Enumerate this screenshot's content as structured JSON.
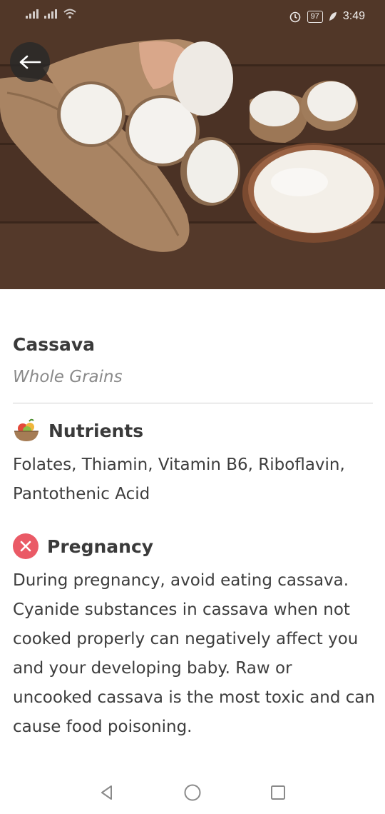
{
  "status_bar": {
    "time": "3:49",
    "battery": "97"
  },
  "food": {
    "name": "Cassava",
    "category": "Whole Grains"
  },
  "nutrients": {
    "heading": "Nutrients",
    "text": "Folates, Thiamin, Vitamin B6, Riboflavin, Pantothenic Acid",
    "icon": "fruit-bowl-icon"
  },
  "pregnancy": {
    "heading": "Pregnancy",
    "text": "During pregnancy, avoid eating cassava. Cyanide substances in cassava when not cooked properly can  negatively affect you and your developing baby. Raw or uncooked cassava is the most toxic and can cause food poisoning.",
    "icon": "close-circle-icon",
    "color": "#ea5a66"
  },
  "nav": {
    "back": "back-triangle-icon",
    "home": "home-circle-icon",
    "recents": "recents-square-icon"
  }
}
